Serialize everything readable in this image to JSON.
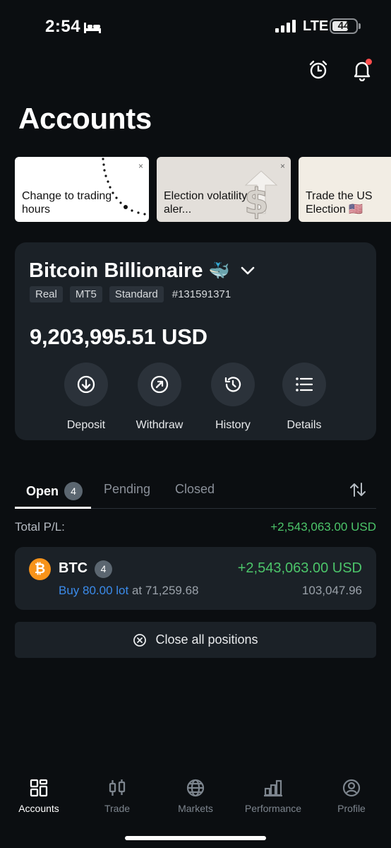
{
  "status_bar": {
    "time": "2:54",
    "network": "LTE",
    "battery": "44"
  },
  "header": {
    "title": "Accounts"
  },
  "promos": [
    {
      "text": "Change to trading hours",
      "close": "×"
    },
    {
      "text": "Election volatility aler...",
      "close": "×"
    },
    {
      "text": "Trade the US Election 🇺🇸"
    }
  ],
  "account": {
    "name": "Bitcoin Billionaire",
    "emoji": "🐳",
    "tags": [
      "Real",
      "MT5",
      "Standard"
    ],
    "number": "#131591371",
    "balance": "9,203,995.51 USD",
    "actions": {
      "deposit": "Deposit",
      "withdraw": "Withdraw",
      "history": "History",
      "details": "Details"
    }
  },
  "tabs": {
    "open": "Open",
    "open_count": "4",
    "pending": "Pending",
    "closed": "Closed"
  },
  "total": {
    "label": "Total P/L:",
    "value": "+2,543,063.00 USD"
  },
  "position": {
    "symbol": "BTC",
    "icon_letter": "₿",
    "count": "4",
    "pnl": "+2,543,063.00 USD",
    "side_lot": "Buy 80.00 lot",
    "at_text": " at 71,259.68",
    "current_price": "103,047.96"
  },
  "close_all_label": "Close all positions",
  "nav": {
    "accounts": "Accounts",
    "trade": "Trade",
    "markets": "Markets",
    "performance": "Performance",
    "profile": "Profile"
  },
  "colors": {
    "background": "#0b0e11",
    "card": "#1b2127",
    "profit": "#4cc56a",
    "buy": "#3b8bea",
    "notification": "#ff4d4d",
    "btc": "#f7931a"
  }
}
